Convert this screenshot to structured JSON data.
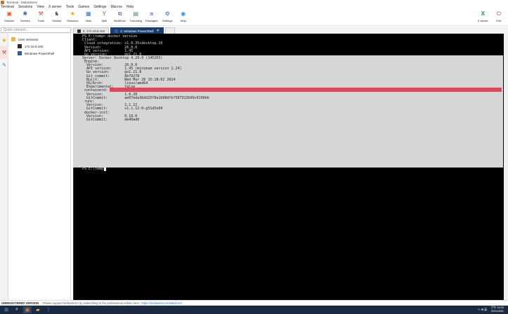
{
  "window": {
    "title": "Terminal - MobaXterm"
  },
  "menu": [
    "Terminal",
    "Sessions",
    "View",
    "X server",
    "Tools",
    "Games",
    "Settings",
    "Macros",
    "Help"
  ],
  "toolbar": [
    {
      "label": "Session",
      "icon": "session-icon",
      "color": "#e05a2b"
    },
    {
      "label": "Servers",
      "icon": "servers-icon",
      "color": "#2d6fb5"
    },
    {
      "label": "Tools",
      "icon": "tools-icon",
      "color": "#d24a3c"
    },
    {
      "label": "Games",
      "icon": "games-icon",
      "color": "#5a5a5a"
    },
    {
      "label": "Sessions",
      "icon": "sessions-star-icon",
      "color": "#e6a800"
    },
    {
      "label": "View",
      "icon": "view-icon",
      "color": "#3a78c4"
    },
    {
      "label": "Split",
      "icon": "split-icon",
      "color": "#8e44ad"
    },
    {
      "label": "MultiExec",
      "icon": "multiexec-icon",
      "color": "#6b4a9a"
    },
    {
      "label": "Tunneling",
      "icon": "tunneling-icon",
      "color": "#3c8d5e"
    },
    {
      "label": "Packages",
      "icon": "packages-icon",
      "color": "#6a5acd"
    },
    {
      "label": "Settings",
      "icon": "settings-icon",
      "color": "#2d6fb5"
    },
    {
      "label": "Help",
      "icon": "help-icon",
      "color": "#2d8fd8"
    }
  ],
  "toolbar_right": [
    {
      "label": "X server",
      "icon": "x-server-icon"
    },
    {
      "label": "Exit",
      "icon": "exit-icon"
    }
  ],
  "quick_connect": {
    "placeholder": "Quick connect..."
  },
  "tabs": [
    {
      "label": "3. 172.16.8.182",
      "active": false
    },
    {
      "label": "2. Windows PowerShell",
      "active": true
    }
  ],
  "sessions": {
    "root": "User sessions",
    "items": [
      "172.16.8.182",
      "Windows PowerShell"
    ]
  },
  "terminal": {
    "command": "PS E:\\temp> docker version",
    "client": [
      "Client:",
      " Cloud integration: v1.0.35+desktop.10",
      " Version:           26.0.0",
      " API version:       1.45",
      " Go version:        go1.21.8",
      " Git commit:        2ae903e",
      " Built:             Wed Mar 20 15:18:56 2024",
      " OS/Arch:           windows/amd64",
      " Context:           default"
    ],
    "server": [
      "Server: Docker Desktop 4.29.0 (145265)",
      " Engine:",
      "  Version:          26.0.0",
      "  API version:      1.45 (minimum version 1.24)",
      "  Go version:       go1.21.8",
      "  Git commit:       8b79278",
      "  Built:            Wed Mar 20 15:18:01 2024",
      "  OS/Arch:          linux/amd64",
      "  Experimental:     false",
      " containerd:",
      "  Version:          1.6.28",
      "  GitCommit:        ae07eda36dd25f8a1b98dfbf587313b99c0190bb",
      " runc:",
      "  Version:          1.1.12",
      "  GitCommit:        v1.1.12-0-g51d5e94",
      " docker-init:",
      "  Version:          0.19.0",
      "  GitCommit:        de40ad0"
    ],
    "prompt": "PS E:\\temp>"
  },
  "status": {
    "unregistered": "UNREGISTERED VERSION",
    "message": "- Please support MobaXterm by subscribing to the professional edition here:",
    "link": "https://mobaxterm.mobatek.net"
  },
  "taskbar": {
    "time": "下午 11:00",
    "date": "2024/4/28",
    "tray": "へ ⊞ 英"
  }
}
